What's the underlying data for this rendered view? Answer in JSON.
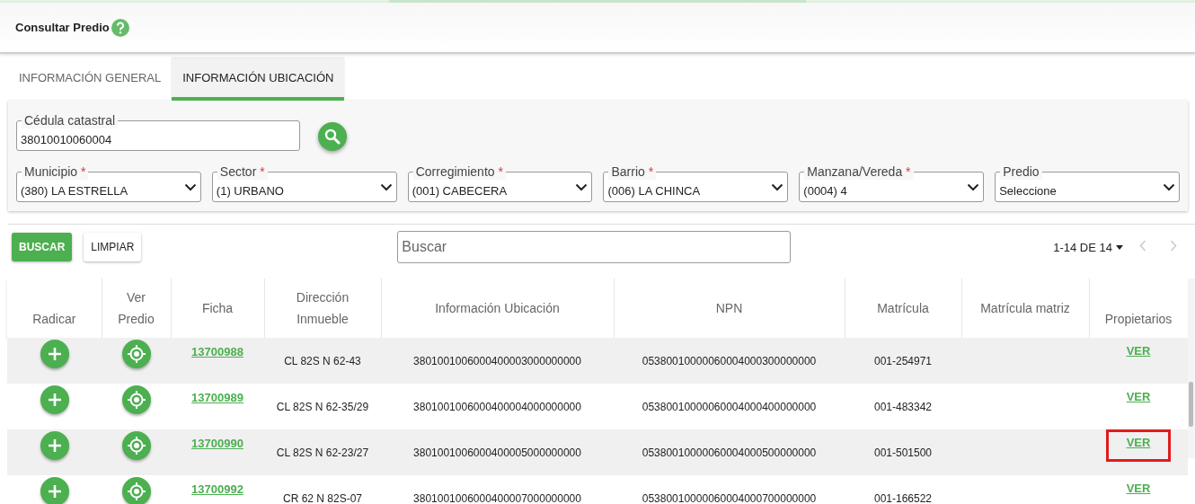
{
  "page": {
    "title": "Consultar Predio"
  },
  "tabs": [
    {
      "label": "INFORMACIÓN GENERAL",
      "selected": false
    },
    {
      "label": "INFORMACIÓN UBICACIÓN",
      "selected": true
    }
  ],
  "cedula": {
    "label": "Cédula catastral",
    "value": "38010010060004"
  },
  "required_mark": "*",
  "selects": [
    {
      "label": "Municipio",
      "required": true,
      "value": "(380) LA ESTRELLA"
    },
    {
      "label": "Sector",
      "required": true,
      "value": "(1) URBANO"
    },
    {
      "label": "Corregimiento",
      "required": true,
      "value": "(001) CABECERA"
    },
    {
      "label": "Barrio",
      "required": true,
      "value": "(006) LA CHINCA"
    },
    {
      "label": "Manzana/Vereda",
      "required": true,
      "value": "(0004) 4"
    },
    {
      "label": "Predio",
      "required": false,
      "value": "Seleccione"
    }
  ],
  "buttons": [
    {
      "label": "BUSCAR",
      "kind": "primary"
    },
    {
      "label": "LIMPIAR",
      "kind": "secondary"
    }
  ],
  "search": {
    "placeholder": "Buscar"
  },
  "pagination": {
    "range": "1-14 DE 14",
    "prev_disabled": true,
    "next_disabled": true
  },
  "table": {
    "columns": [
      "Radicar",
      "Ver Predio",
      "Ficha",
      "Dirección Inmueble",
      "Información Ubicación",
      "NPN",
      "Matrícula",
      "Matrícula matriz",
      "Propietarios"
    ],
    "rows": [
      {
        "ficha": "13700988",
        "direccion": "CL 82S N 62-43",
        "ubicacion": "3801001006000400003000000000",
        "npn": "05380010000060004000300000000",
        "matricula": "001-254971",
        "propietarios": "VER",
        "highlighted": false
      },
      {
        "ficha": "13700989",
        "direccion": "CL 82S N 62-35/29",
        "ubicacion": "3801001006000400004000000000",
        "npn": "05380010000060004000400000000",
        "matricula": "001-483342",
        "propietarios": "VER",
        "highlighted": false
      },
      {
        "ficha": "13700990",
        "direccion": "CL 82S N 62-23/27",
        "ubicacion": "3801001006000400005000000000",
        "npn": "05380010000060004000500000000",
        "matricula": "001-501500",
        "propietarios": "VER",
        "highlighted": true
      },
      {
        "ficha": "13700992",
        "direccion": "CR 62 N 82S-07",
        "ubicacion": "3801001006000400007000000000",
        "npn": "05380010000060004000700000000",
        "matricula": "001-166522",
        "propietarios": "VER",
        "highlighted": false
      }
    ]
  }
}
